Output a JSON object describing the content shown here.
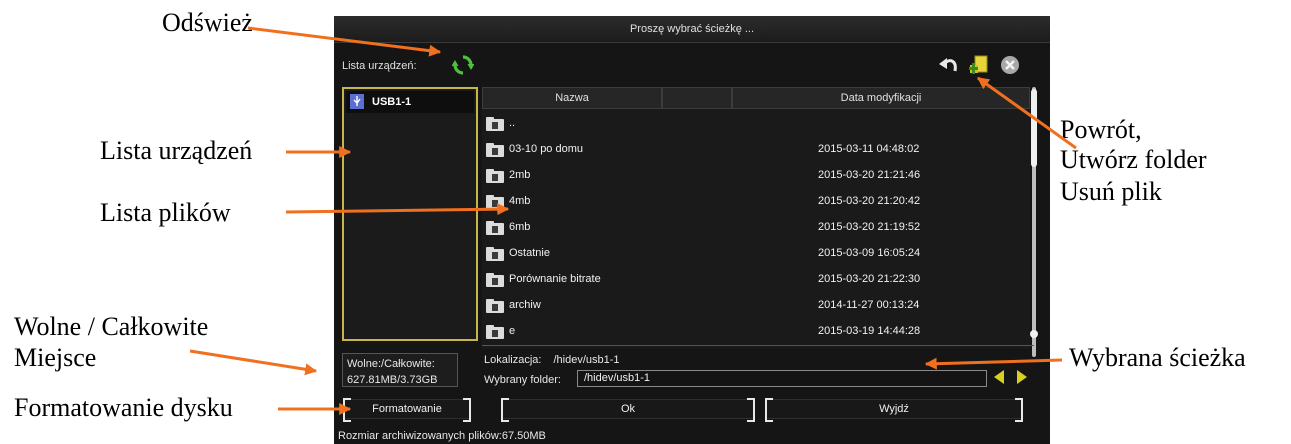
{
  "annotations": {
    "refresh": "Odśwież",
    "device_list": "Lista urządzeń",
    "file_list": "Lista plików",
    "free_total_line1": "Wolne / Całkowite",
    "free_total_line2": "Miejsce",
    "format_disk": "Formatowanie dysku",
    "back_line": "Powrót,",
    "create_folder_line": "Utwórz folder",
    "delete_file_line": "Usuń plik",
    "selected_path": "Wybrana ścieżka"
  },
  "dialog": {
    "title": "Proszę wybrać ścieżkę ...",
    "device_list_label": "Lista urządzeń:",
    "devices": [
      {
        "label": "USB1-1",
        "icon": "usb-icon"
      }
    ],
    "columns": {
      "name": "Nazwa",
      "date": "Data modyfikacji"
    },
    "files": [
      {
        "name": "..",
        "date": ""
      },
      {
        "name": "03-10 po domu",
        "date": "2015-03-11 04:48:02"
      },
      {
        "name": "2mb",
        "date": "2015-03-20 21:21:46"
      },
      {
        "name": "4mb",
        "date": "2015-03-20 21:20:42"
      },
      {
        "name": "6mb",
        "date": "2015-03-20 21:19:52"
      },
      {
        "name": "Ostatnie",
        "date": "2015-03-09 16:05:24"
      },
      {
        "name": "Porównanie bitrate",
        "date": "2015-03-20 21:22:30"
      },
      {
        "name": "archiw",
        "date": "2014-11-27 00:13:24"
      },
      {
        "name": "e",
        "date": "2015-03-19 14:44:28"
      }
    ],
    "free_total_label": "Wolne:/Całkowite:",
    "free_total_value": "627.81MB/3.73GB",
    "location_label": "Lokalizacja:",
    "location_value": "/hidev/usb1-1",
    "selected_folder_label": "Wybrany folder:",
    "selected_folder_value": "/hidev/usb1-1",
    "format_button": "Formatowanie",
    "ok_button": "Ok",
    "exit_button": "Wyjdź",
    "archive_size": "Rozmiar archiwizowanych plików:67.50MB"
  },
  "colors": {
    "accent_yellow": "#d8d020",
    "refresh_green": "#4cc23a",
    "arrow_orange": "#f07020",
    "device_border": "#c9b64a"
  }
}
